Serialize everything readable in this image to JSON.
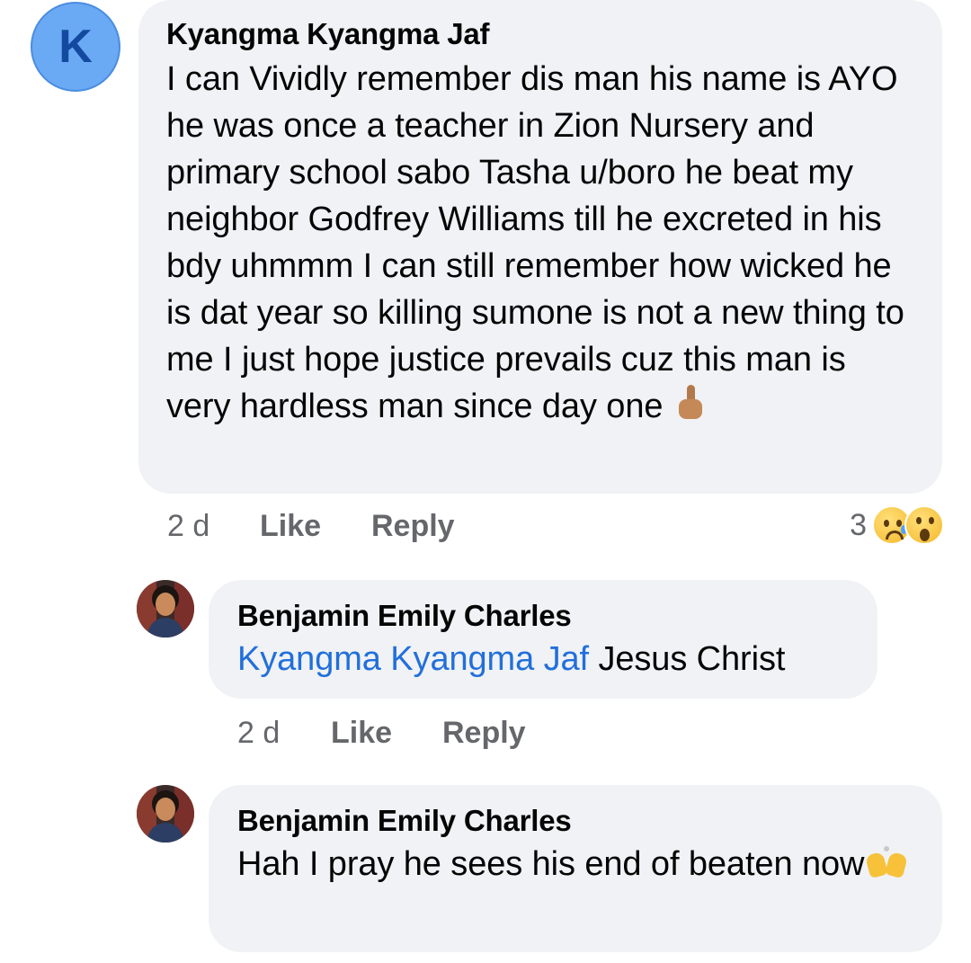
{
  "comment": {
    "avatar_letter": "K",
    "author": "Kyangma Kyangma Jaf",
    "text": "I can Vividly remember dis man his name is AYO he was once a teacher in Zion Nursery and primary school sabo Tasha u/boro he beat my neighbor Godfrey Williams till he excreted in his bdy uhmmm I can still remember how wicked he is dat year so killing sumone is not a new thing to me I just hope justice prevails cuz this man is very hardless man since day one",
    "text_emoji": "pointing-up-icon",
    "time": "2 d",
    "like_label": "Like",
    "reply_label": "Reply",
    "reaction_count": "3",
    "reactions": [
      "sad-face-icon",
      "wow-face-icon"
    ]
  },
  "replies": [
    {
      "author": "Benjamin Emily Charles",
      "mention": "Kyangma Kyangma Jaf",
      "text": "Jesus Christ",
      "time": "2 d",
      "like_label": "Like",
      "reply_label": "Reply"
    },
    {
      "author": "Benjamin Emily Charles",
      "text": "Hah I pray he sees his end of beaten now",
      "text_emoji": "raising-hands-icon"
    }
  ],
  "colors": {
    "bubble_bg": "#f0f2f5",
    "mention": "#216fdb",
    "meta": "#65676b",
    "avatar_bg": "#6aa9f3"
  }
}
